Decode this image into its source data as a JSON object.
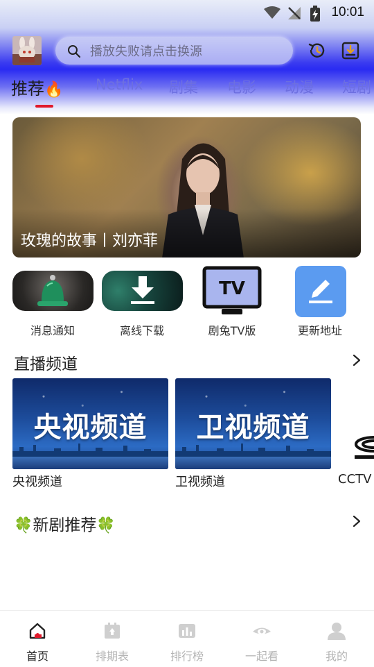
{
  "status_bar": {
    "time": "10:01"
  },
  "header": {
    "search_placeholder": "播放失败请点击换源"
  },
  "tabs": [
    {
      "label": "推荐",
      "emoji": "🔥"
    },
    {
      "label": "Netflix"
    },
    {
      "label": "剧集"
    },
    {
      "label": "电影"
    },
    {
      "label": "动漫"
    },
    {
      "label": "短剧"
    }
  ],
  "banner": {
    "caption": "玫瑰的故事丨刘亦菲"
  },
  "quick_actions": [
    {
      "label": "消息通知",
      "icon": "bell-icon"
    },
    {
      "label": "离线下载",
      "icon": "download-icon"
    },
    {
      "label": "剧兔TV版",
      "icon": "tv-icon",
      "badge": "TV"
    },
    {
      "label": "更新地址",
      "icon": "edit-icon"
    }
  ],
  "live_section": {
    "title": "直播频道",
    "channels": [
      {
        "card_title": "央视频道",
        "label": "央视频道"
      },
      {
        "card_title": "卫视频道",
        "label": "卫视频道"
      },
      {
        "label": "CCTV"
      }
    ]
  },
  "new_drama_section": {
    "title": "新剧推荐",
    "emoji": "🍀"
  },
  "bottom_nav": [
    {
      "label": "首页",
      "icon": "home-icon",
      "active": true
    },
    {
      "label": "排期表",
      "icon": "calendar-icon"
    },
    {
      "label": "排行榜",
      "icon": "ranking-icon"
    },
    {
      "label": "一起看",
      "icon": "eye-icon"
    },
    {
      "label": "我的",
      "icon": "user-icon"
    }
  ],
  "colors": {
    "accent_red": "#e0192b",
    "tab_inactive": "#6d6fe0",
    "edit_blue": "#5b9bf0"
  }
}
